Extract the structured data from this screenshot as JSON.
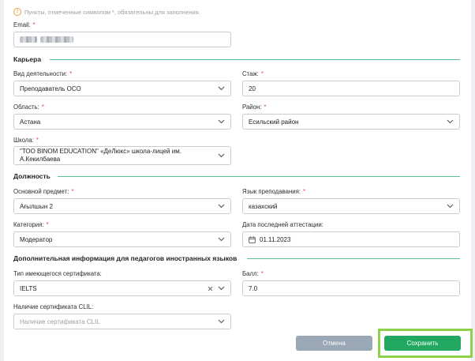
{
  "notice": "Пункты, отмеченные символом *, обязательны для заполнения.",
  "required_mark": "*",
  "email": {
    "label": "Email:"
  },
  "career": {
    "title": "Карьера",
    "activity": {
      "label": "Вид деятельности:",
      "value": "Преподаватель ОСО"
    },
    "experience": {
      "label": "Стаж:",
      "value": "20"
    },
    "region": {
      "label": "Область:",
      "value": "Астана"
    },
    "district": {
      "label": "Район:",
      "value": "Есильский район"
    },
    "school": {
      "label": "Школа:",
      "value_line1": "\"ТОО BINOM EDUCATION\" «ДеЛюкс» школа-лицей им.",
      "value_line2": "А.Кекилбаева"
    }
  },
  "position": {
    "title": "Должность",
    "subject": {
      "label": "Основной предмет:",
      "value": "Ағылшын 2"
    },
    "language": {
      "label": "Язык преподавания:",
      "value": "казахский"
    },
    "category": {
      "label": "Категория:",
      "value": "Модератор"
    },
    "attestation": {
      "label": "Дата последней аттестации:",
      "value": "01.11.2023"
    }
  },
  "foreign": {
    "title": "Дополнительная информация для педагогов иностранных языков",
    "cert_type": {
      "label": "Тип имеющегося сертификата:",
      "value": "IELTS"
    },
    "score": {
      "label": "Балл:",
      "value": "7.0"
    },
    "clil": {
      "label": "Наличие сертификата CLIL:",
      "placeholder": "Наличие сертификата CLIL"
    }
  },
  "buttons": {
    "cancel": "Отмена",
    "save": "Сохранить"
  },
  "colors": {
    "accent_green": "#22a861",
    "cancel_gray": "#9aa7b4",
    "required_red": "#e5484d",
    "section_line": "#5bbf8f",
    "highlight": "#8fd14f"
  }
}
